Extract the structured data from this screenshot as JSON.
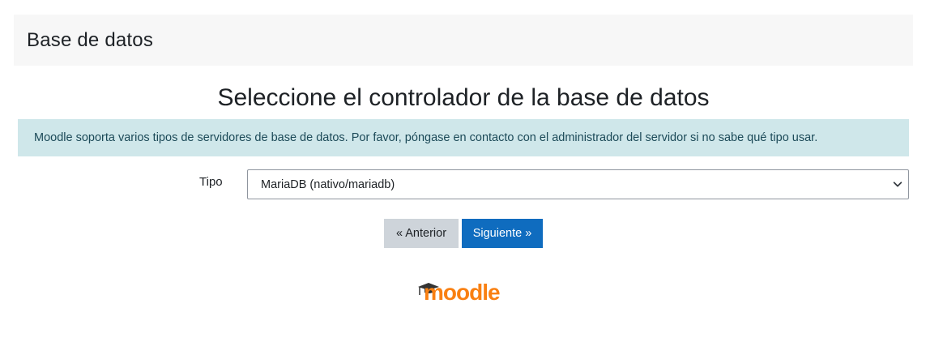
{
  "header": {
    "title": "Base de datos"
  },
  "main": {
    "heading": "Seleccione el controlador de la base de datos",
    "info": "Moodle soporta varios tipos de servidores de base de datos. Por favor, póngase en contacto con el administrador del servidor si no sabe qué tipo usar."
  },
  "form": {
    "type_label": "Tipo",
    "type_selected": "MariaDB (nativo/mariadb)"
  },
  "buttons": {
    "prev_label": "« Anterior",
    "next_label": "Siguiente »"
  },
  "logo": {
    "text": "moodle",
    "icon": "mortarboard-icon"
  },
  "colors": {
    "header_bg": "#f7f7f7",
    "info_bg": "#cfe7ea",
    "info_text": "#1c4a58",
    "primary": "#0f6cbf",
    "secondary": "#ced4da",
    "logo_orange": "#f98012",
    "logo_cap": "#333333"
  }
}
